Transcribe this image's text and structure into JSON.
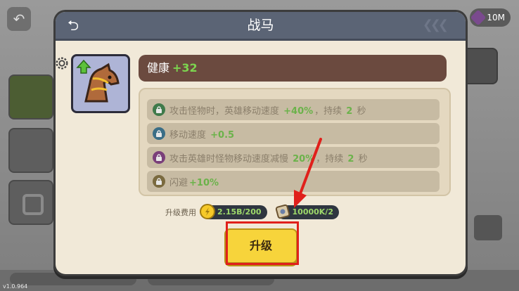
{
  "background": {
    "gem_count": "10M",
    "version": "v1.0.964"
  },
  "modal": {
    "title": "战马",
    "health": {
      "label": "健康",
      "bonus": "+32"
    },
    "stats": [
      {
        "parts": [
          [
            "攻击怪物时，英雄移动速度 ",
            false
          ],
          [
            "+40%",
            true
          ],
          [
            "，持续 ",
            false
          ],
          [
            "2",
            true
          ],
          [
            " 秒",
            false
          ]
        ],
        "lock_color": "#3f7a4a"
      },
      {
        "parts": [
          [
            "移动速度 ",
            false
          ],
          [
            "+0.5",
            true
          ]
        ],
        "lock_color": "#3b6e86"
      },
      {
        "parts": [
          [
            "攻击英雄时怪物移动速度减慢 ",
            false
          ],
          [
            "20%",
            true
          ],
          [
            "，持续 ",
            false
          ],
          [
            "2",
            true
          ],
          [
            " 秒",
            false
          ]
        ],
        "lock_color": "#7a3f7a"
      },
      {
        "parts": [
          [
            "闪避",
            false
          ],
          [
            "+10%",
            true
          ]
        ],
        "lock_color": "#7a6a3f"
      }
    ],
    "cost": {
      "label": "升级费用",
      "gold": "2.15B/200",
      "scroll": "10000K/2"
    },
    "upgrade_label": "升级"
  },
  "colors": {
    "header": "#5b6475",
    "health_bar": "#6b4a3f",
    "bonus_green": "#7cd44f",
    "button_yellow": "#f7d43b",
    "annotation_red": "#e0201b"
  }
}
